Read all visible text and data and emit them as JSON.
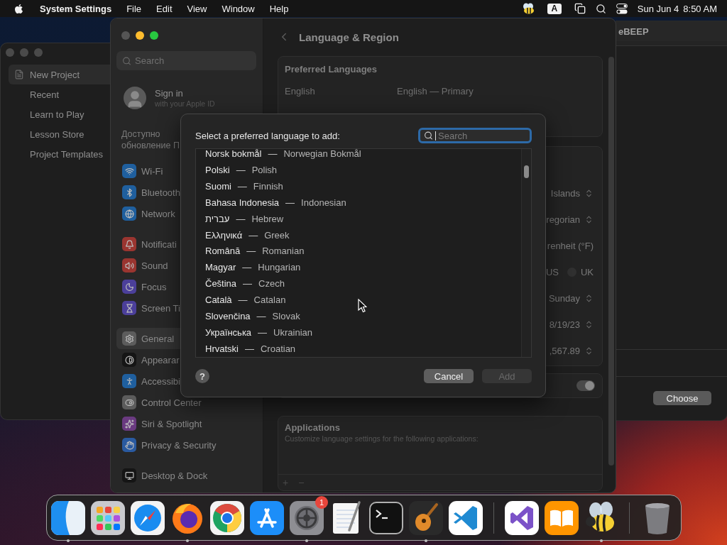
{
  "menu_bar": {
    "app_name": "System Settings",
    "menus": [
      "File",
      "Edit",
      "View",
      "Window",
      "Help"
    ],
    "input_source": "A",
    "date": "Sun Jun 4",
    "time": "8:50 AM"
  },
  "project_window": {
    "items": [
      {
        "label": "New Project",
        "kind": "document",
        "selected": true
      },
      {
        "label": "Recent",
        "kind": "plain",
        "selected": false
      },
      {
        "label": "Learn to Play",
        "kind": "plain",
        "selected": false
      },
      {
        "label": "Lesson Store",
        "kind": "plain",
        "selected": false
      },
      {
        "label": "Project Templates",
        "kind": "plain",
        "selected": false
      }
    ]
  },
  "chooser_window": {
    "title": "eBEEP",
    "button": "Choose"
  },
  "settings": {
    "search": {
      "placeholder": "Search"
    },
    "account": {
      "title": "Sign in",
      "subtitle": "with your Apple ID"
    },
    "update_notice": "Доступно обновление П",
    "sidebar": {
      "groups": [
        {
          "items": [
            {
              "label": "Wi-Fi",
              "kind": "wifi",
              "color": "#1f5f9e",
              "selected": false
            },
            {
              "label": "Bluetooth",
              "kind": "bluetooth",
              "color": "#1f5f9e",
              "selected": false
            },
            {
              "label": "Network",
              "kind": "network",
              "color": "#1f5f9e",
              "selected": false
            }
          ]
        },
        {
          "items": [
            {
              "label": "Notificati",
              "kind": "notifications",
              "color": "#9a3530",
              "selected": false
            },
            {
              "label": "Sound",
              "kind": "sound",
              "color": "#9a3530",
              "selected": false
            },
            {
              "label": "Focus",
              "kind": "focus",
              "color": "#4b3f9a",
              "selected": false
            },
            {
              "label": "Screen Ti",
              "kind": "screentime",
              "color": "#4b3f9a",
              "selected": false
            }
          ]
        },
        {
          "items": [
            {
              "label": "General",
              "kind": "general",
              "color": "#5c5c5c",
              "selected": true
            },
            {
              "label": "Appearar",
              "kind": "appearance",
              "color": "#151515",
              "selected": false
            },
            {
              "label": "Accessibi",
              "kind": "accessibility",
              "color": "#1f5f9e",
              "selected": false
            },
            {
              "label": "Control Center",
              "kind": "controlcenter",
              "color": "#5c5c5c",
              "selected": false
            },
            {
              "label": "Siri & Spotlight",
              "kind": "siri",
              "color": "#6a3a80",
              "selected": false
            },
            {
              "label": "Privacy & Security",
              "kind": "privacy",
              "color": "#2a5aa0",
              "selected": false
            }
          ]
        },
        {
          "items": [
            {
              "label": "Desktop & Dock",
              "kind": "desktop",
              "color": "#151515",
              "selected": false
            }
          ]
        }
      ]
    },
    "page": {
      "title": "Language & Region",
      "preferred_languages": {
        "title": "Preferred Languages",
        "rows": [
          {
            "name": "English",
            "detail": "English — Primary"
          }
        ]
      },
      "format_rows": [
        {
          "kind": "popup",
          "value": "Islands"
        },
        {
          "kind": "popup",
          "value": "regorian"
        },
        {
          "kind": "text",
          "value": "renheit (°F)"
        },
        {
          "kind": "radio",
          "options": [
            {
              "label": "US"
            },
            {
              "label": "UK",
              "selected": false
            }
          ]
        },
        {
          "kind": "popup",
          "value": "Sunday"
        },
        {
          "kind": "popup",
          "value": "8/19/23"
        },
        {
          "kind": "popup",
          "value": ",567.89"
        }
      ],
      "toggle": {
        "on": true
      },
      "applications": {
        "title": "Applications",
        "subtitle": "Customize language settings for the following applications:",
        "add": "+",
        "remove": "−"
      }
    }
  },
  "sheet": {
    "prompt": "Select a preferred language to add:",
    "search": {
      "placeholder": "Search",
      "focused": true
    },
    "languages": [
      {
        "native": "Norsk bokmål",
        "separator": "—",
        "english": "Norwegian Bokmål"
      },
      {
        "native": "Polski",
        "separator": "—",
        "english": "Polish"
      },
      {
        "native": "Suomi",
        "separator": "—",
        "english": "Finnish"
      },
      {
        "native": "Bahasa Indonesia",
        "separator": "—",
        "english": "Indonesian"
      },
      {
        "native": "עברית",
        "separator": "—",
        "english": "Hebrew"
      },
      {
        "native": "Ελληνικά",
        "separator": "—",
        "english": "Greek"
      },
      {
        "native": "Română",
        "separator": "—",
        "english": "Romanian"
      },
      {
        "native": "Magyar",
        "separator": "—",
        "english": "Hungarian"
      },
      {
        "native": "Čeština",
        "separator": "—",
        "english": "Czech"
      },
      {
        "native": "Català",
        "separator": "—",
        "english": "Catalan"
      },
      {
        "native": "Slovenčina",
        "separator": "—",
        "english": "Slovak"
      },
      {
        "native": "Українська",
        "separator": "—",
        "english": "Ukrainian"
      },
      {
        "native": "Hrvatski",
        "separator": "—",
        "english": "Croatian"
      }
    ],
    "help": "?",
    "cancel": "Cancel",
    "add": {
      "label": "Add",
      "disabled": true
    }
  },
  "dock": {
    "groups": [
      {
        "apps": [
          {
            "kind": "finder",
            "running": true
          },
          {
            "kind": "launchpad",
            "running": false
          },
          {
            "kind": "safari",
            "running": false
          },
          {
            "kind": "firefox",
            "running": true
          },
          {
            "kind": "chrome",
            "running": false
          },
          {
            "kind": "appstore",
            "running": false
          },
          {
            "kind": "settings",
            "running": true,
            "badge": "1"
          },
          {
            "kind": "textedit",
            "running": false
          },
          {
            "kind": "terminal",
            "running": false
          },
          {
            "kind": "garageband",
            "running": true
          },
          {
            "kind": "vscode",
            "running": false
          }
        ]
      },
      {
        "apps": [
          {
            "kind": "visualstudio",
            "running": false
          },
          {
            "kind": "books",
            "running": false
          },
          {
            "kind": "bee",
            "running": true
          }
        ]
      },
      {
        "apps": [
          {
            "kind": "trash",
            "running": false
          }
        ]
      }
    ]
  }
}
